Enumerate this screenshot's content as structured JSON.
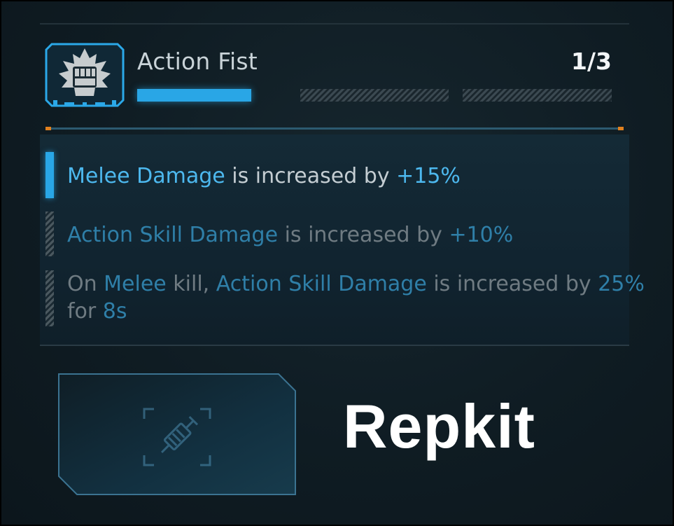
{
  "skill": {
    "title": "Action Fist",
    "rank": "1/3",
    "progress_current": 1,
    "progress_max": 3,
    "icon": "fist-in-leaf-badge-icon"
  },
  "effects": [
    {
      "state": "active",
      "parts": [
        {
          "text": "Melee Damage",
          "hl": true
        },
        {
          "text": " is increased by ",
          "hl": false
        },
        {
          "text": "+15%",
          "hl": true
        }
      ]
    },
    {
      "state": "locked",
      "parts": [
        {
          "text": "Action Skill Damage",
          "hl": true
        },
        {
          "text": " is increased by ",
          "hl": false
        },
        {
          "text": "+10%",
          "hl": true
        }
      ]
    },
    {
      "state": "locked",
      "parts": [
        {
          "text": "On ",
          "hl": false
        },
        {
          "text": "Melee",
          "hl": true
        },
        {
          "text": " kill, ",
          "hl": false
        },
        {
          "text": "Action Skill Damage",
          "hl": true
        },
        {
          "text": " is increased by ",
          "hl": false
        },
        {
          "text": "25%",
          "hl": true
        }
      ],
      "parts2": [
        {
          "text": "for ",
          "hl": false
        },
        {
          "text": "8s",
          "hl": true
        }
      ]
    }
  ],
  "repkit": {
    "label": "Repkit",
    "icon": "syringe-icon"
  },
  "colors": {
    "accent": "#29a6e6",
    "highlight": "#4db8ee",
    "tick": "#e0801e"
  }
}
